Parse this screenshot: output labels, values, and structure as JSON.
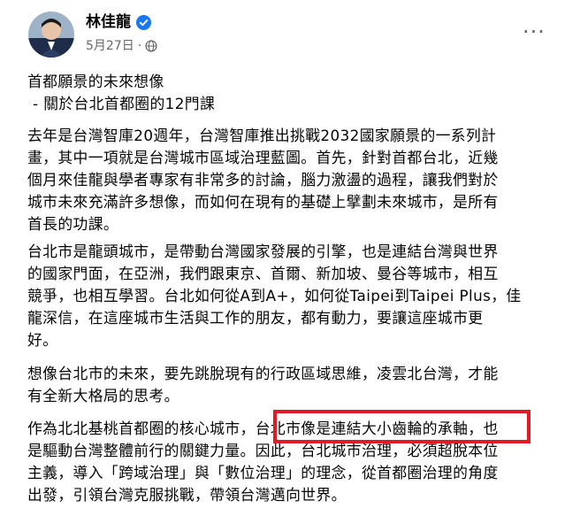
{
  "post": {
    "author": "林佳龍",
    "date": "5月27日",
    "dot": "·",
    "more_label": "···",
    "title_lines": [
      "首都願景的未來想像",
      "- 關於台北首都圈的12門課"
    ],
    "p1_lines": [
      "去年是台灣智庫20週年，台灣智庫推出挑戰2032國家願景的一系列計",
      "畫，其中一項就是台灣城市區域治理藍圖。首先，針對首都台北，近幾",
      "個月來佳龍與學者專家有非常多的討論，腦力激盪的過程，讓我們對於",
      "城市未來充滿許多想像，而如何在現有的基礎上擘劃未來城市，是所有",
      "首長的功課。"
    ],
    "p2_lines": [
      "台北市是龍頭城市，是帶動台灣國家發展的引擎，也是連結台灣與世界",
      "的國家門面，在亞洲，我們跟東京、首爾、新加坡、曼谷等城市，相互",
      "競爭，也相互學習。台北如何從A到A+，如何從Taipei到Taipei Plus，佳",
      "龍深信，在這座城市生活與工作的朋友，都有動力，要讓這座城市更",
      "好。"
    ],
    "p3_lines": [
      "想像台北市的未來，要先跳脫現有的行政區域思維，凌雲北台灣，才能",
      "有全新大格局的思考。"
    ],
    "p4_lines": [
      "作為北北基桃首都圈的核心城市，台北市像是連結大小齒輪的承軸，也",
      "是驅動台灣整體前行的關鍵力量。因此，台北城市治理，必須超脫本位",
      "主義，導入「跨域治理」與「數位治理」的理念，從首都圈治理的角度",
      "出發，引領台灣克服挑戰，帶領台灣邁向世界。"
    ],
    "highlight_text": "台北市像是連結大小齒輪的承軸",
    "colors": {
      "highlight_border": "#e01b24",
      "verified_badge": "#1877f2",
      "meta_text": "#65676b"
    },
    "icons": [
      "verified-badge-icon",
      "globe-icon",
      "more-options-icon"
    ]
  }
}
